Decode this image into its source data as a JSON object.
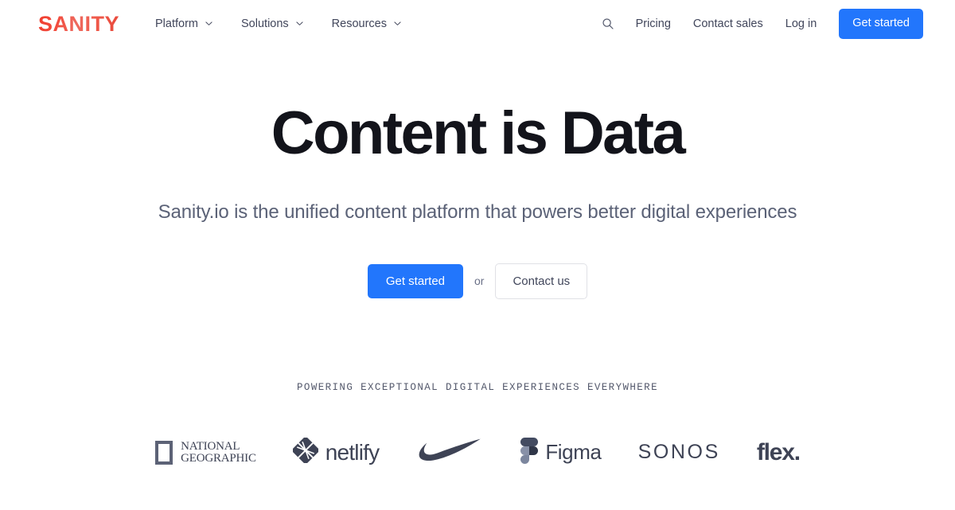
{
  "brand": {
    "logo_text": "SANITY",
    "logo_gradient_from": "#F03E2F",
    "logo_gradient_to": "#EE6A5F"
  },
  "colors": {
    "accent_blue": "#2276FC",
    "heading": "#13141B",
    "body_text": "#5B6277",
    "nav_text": "#41465B",
    "border": "#E0E1E6",
    "logo_gray": "#3E4355",
    "background": "#FFFFFF"
  },
  "header": {
    "nav_items": [
      {
        "label": "Platform",
        "icon": "chevron-down-icon"
      },
      {
        "label": "Solutions",
        "icon": "chevron-down-icon"
      },
      {
        "label": "Resources",
        "icon": "chevron-down-icon"
      }
    ],
    "search_icon": "search-icon",
    "links": [
      {
        "label": "Pricing"
      },
      {
        "label": "Contact sales"
      },
      {
        "label": "Log in"
      }
    ],
    "cta_label": "Get started"
  },
  "hero": {
    "title": "Content is Data",
    "subtitle": "Sanity.io is the unified content platform that powers better digital experiences",
    "primary_cta": "Get started",
    "conjunction": "or",
    "secondary_cta": "Contact us"
  },
  "social_proof": {
    "eyebrow": "POWERING EXCEPTIONAL DIGITAL EXPERIENCES EVERYWHERE",
    "logos": [
      {
        "name": "national-geographic",
        "line1": "NATIONAL",
        "line2": "GEOGRAPHIC"
      },
      {
        "name": "netlify",
        "wordmark": "netlify"
      },
      {
        "name": "nike",
        "wordmark": ""
      },
      {
        "name": "figma",
        "wordmark": "Figma"
      },
      {
        "name": "sonos",
        "wordmark": "SONOS"
      },
      {
        "name": "flex",
        "wordmark": "flex."
      }
    ]
  }
}
